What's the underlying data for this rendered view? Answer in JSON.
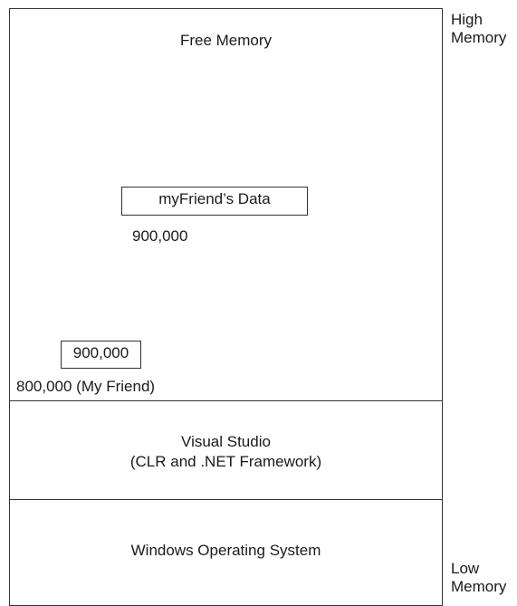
{
  "regions": {
    "free_memory": "Free Memory",
    "visual_studio_line1": "Visual Studio",
    "visual_studio_line2": "(CLR and .NET Framework)",
    "windows_os": "Windows Operating System"
  },
  "heap_object": {
    "label": "myFriend’s Data",
    "address": "900,000"
  },
  "stack_variable": {
    "value": "900,000",
    "address_label": "800,000 (My Friend)"
  },
  "side_labels": {
    "high_line1": "High",
    "high_line2": "Memory",
    "low_line1": "Low",
    "low_line2": "Memory"
  }
}
